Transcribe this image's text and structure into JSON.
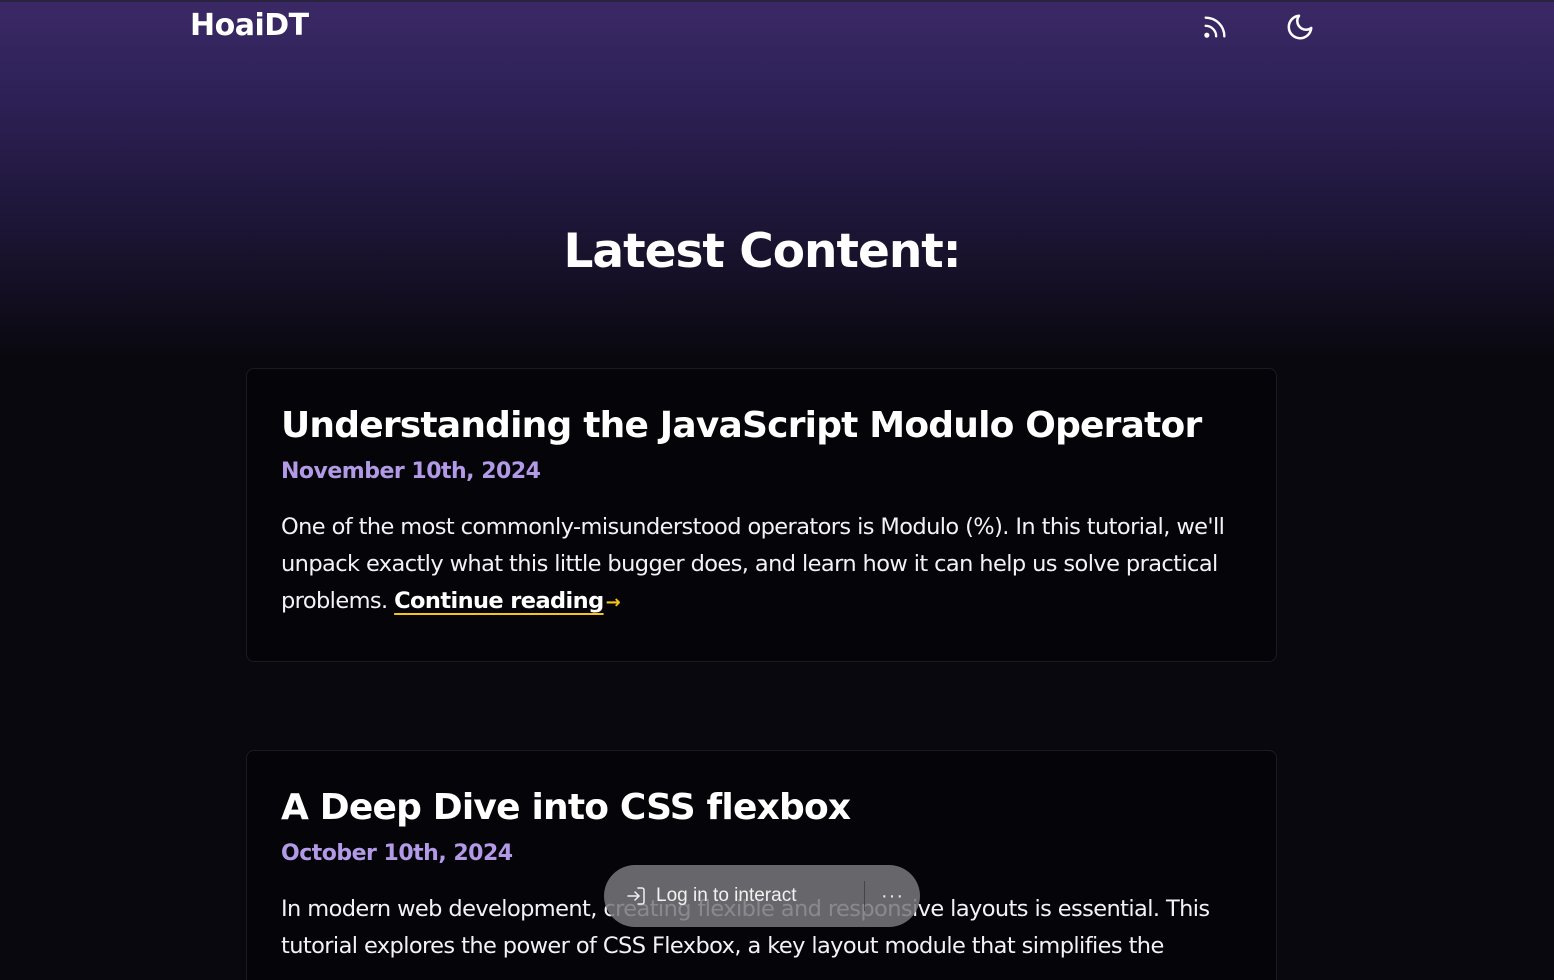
{
  "site": {
    "logo": "HoaiDT"
  },
  "header": {
    "icons": [
      "rss-icon",
      "moon-icon"
    ]
  },
  "main": {
    "title": "Latest Content:",
    "posts": [
      {
        "title": "Understanding the JavaScript Modulo Operator",
        "date": "November 10th, 2024",
        "excerpt": "One of the most commonly-misunderstood operators is Modulo (%). In this tutorial, we'll unpack exactly what this little bugger does, and learn how it can help us solve practical problems. ",
        "read_more": "Continue reading",
        "arrow": "→"
      },
      {
        "title": "A Deep Dive into CSS flexbox",
        "date": "October 10th, 2024",
        "excerpt": "In modern web development, creating flexible and responsive layouts is essential. This tutorial explores the power of CSS Flexbox, a key layout module that simplifies the"
      }
    ]
  },
  "overlay": {
    "login_label": "Log in to interact",
    "more_label": "···"
  },
  "colors": {
    "accent_date": "#b39ae6",
    "link_underline": "#f5c518",
    "header_gradient_top": "#3b2966",
    "background": "#09080e"
  }
}
